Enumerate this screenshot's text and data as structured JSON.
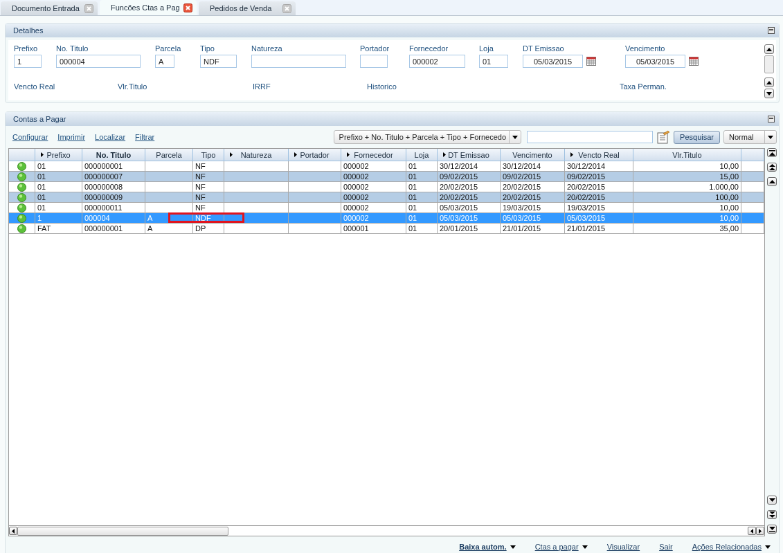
{
  "tabs": [
    {
      "label": "Documento Entrada",
      "selected": false
    },
    {
      "label": "Funcões Ctas a Pag",
      "selected": true
    },
    {
      "label": "Pedidos de Venda",
      "selected": false
    }
  ],
  "details": {
    "title": "Detalhes",
    "fields": [
      {
        "label": "Prefixo",
        "value": "1",
        "kind": "text"
      },
      {
        "label": "No. Titulo",
        "value": "000004",
        "kind": "text"
      },
      {
        "label": "Parcela",
        "value": "A",
        "kind": "text"
      },
      {
        "label": "Tipo",
        "value": "NDF",
        "kind": "text"
      },
      {
        "label": "Natureza",
        "kind": "text"
      },
      {
        "label": "Portador",
        "kind": "text"
      },
      {
        "label": "Fornecedor",
        "value": "000002",
        "kind": "text"
      },
      {
        "label": "Loja",
        "value": "01",
        "kind": "text"
      },
      {
        "label": "DT Emissao",
        "value": "05/03/2015",
        "kind": "date"
      },
      {
        "label": "Vencimento",
        "value": "05/03/2015",
        "kind": "date"
      }
    ],
    "more_labels": [
      "Vencto Real",
      "Vlr.Titulo",
      "IRRF",
      "Historico",
      "Taxa Perman."
    ]
  },
  "contas": {
    "title": "Contas a Pagar",
    "links": [
      "Configurar",
      "Imprimir",
      "Localizar",
      "Filtrar"
    ],
    "index_order": "Prefixo + No. Titulo + Parcela + Tipo + Fornecedo",
    "search_button": "Pesquisar",
    "mode": "Normal",
    "columns": [
      {
        "label": "Prefixo",
        "arrow": true,
        "bold": false
      },
      {
        "label": "No. Titulo",
        "arrow": false,
        "bold": true
      },
      {
        "label": "Parcela",
        "arrow": false,
        "bold": false
      },
      {
        "label": "Tipo",
        "arrow": false,
        "bold": false
      },
      {
        "label": "Natureza",
        "arrow": true,
        "bold": false
      },
      {
        "label": "Portador",
        "arrow": true,
        "bold": false
      },
      {
        "label": "Fornecedor",
        "arrow": true,
        "bold": false
      },
      {
        "label": "Loja",
        "arrow": false,
        "bold": false
      },
      {
        "label": "DT Emissao",
        "arrow": true,
        "bold": false
      },
      {
        "label": "Vencimento",
        "arrow": false,
        "bold": false
      },
      {
        "label": "Vencto Real",
        "arrow": true,
        "bold": false
      },
      {
        "label": "Vlr.Titulo",
        "arrow": false,
        "bold": false
      }
    ],
    "rows": [
      {
        "selected": false,
        "highlighted": false,
        "cells": [
          "01",
          "000000001",
          "",
          "NF",
          "",
          "",
          "000002",
          "01",
          "30/12/2014",
          "30/12/2014",
          "30/12/2014",
          "10,00"
        ]
      },
      {
        "selected": false,
        "highlighted": false,
        "cells": [
          "01",
          "000000007",
          "",
          "NF",
          "",
          "",
          "000002",
          "01",
          "09/02/2015",
          "09/02/2015",
          "09/02/2015",
          "15,00"
        ]
      },
      {
        "selected": false,
        "highlighted": false,
        "cells": [
          "01",
          "000000008",
          "",
          "NF",
          "",
          "",
          "000002",
          "01",
          "20/02/2015",
          "20/02/2015",
          "20/02/2015",
          "1.000,00"
        ]
      },
      {
        "selected": false,
        "highlighted": false,
        "cells": [
          "01",
          "000000009",
          "",
          "NF",
          "",
          "",
          "000002",
          "01",
          "20/02/2015",
          "20/02/2015",
          "20/02/2015",
          "100,00"
        ]
      },
      {
        "selected": false,
        "highlighted": false,
        "cells": [
          "01",
          "000000011",
          "",
          "NF",
          "",
          "",
          "000002",
          "01",
          "05/03/2015",
          "19/03/2015",
          "19/03/2015",
          "10,00"
        ]
      },
      {
        "selected": true,
        "highlighted": true,
        "cells": [
          "1",
          "000004",
          "A",
          "NDF",
          "",
          "",
          "000002",
          "01",
          "05/03/2015",
          "05/03/2015",
          "05/03/2015",
          "10,00"
        ]
      },
      {
        "selected": false,
        "highlighted": false,
        "cells": [
          "FAT",
          "000000001",
          "A",
          "DP",
          "",
          "",
          "000001",
          "01",
          "20/01/2015",
          "21/01/2015",
          "21/01/2015",
          "35,00"
        ]
      }
    ]
  },
  "footer": [
    {
      "label": "Baixa autom.",
      "menu": true,
      "bold": true
    },
    {
      "label": "Ctas a pagar",
      "menu": true,
      "bold": false
    },
    {
      "label": "Visualizar",
      "menu": false,
      "bold": false
    },
    {
      "label": "Sair",
      "menu": false,
      "bold": false
    },
    {
      "label": "Ações Relacionadas",
      "menu": true,
      "bold": false
    }
  ]
}
